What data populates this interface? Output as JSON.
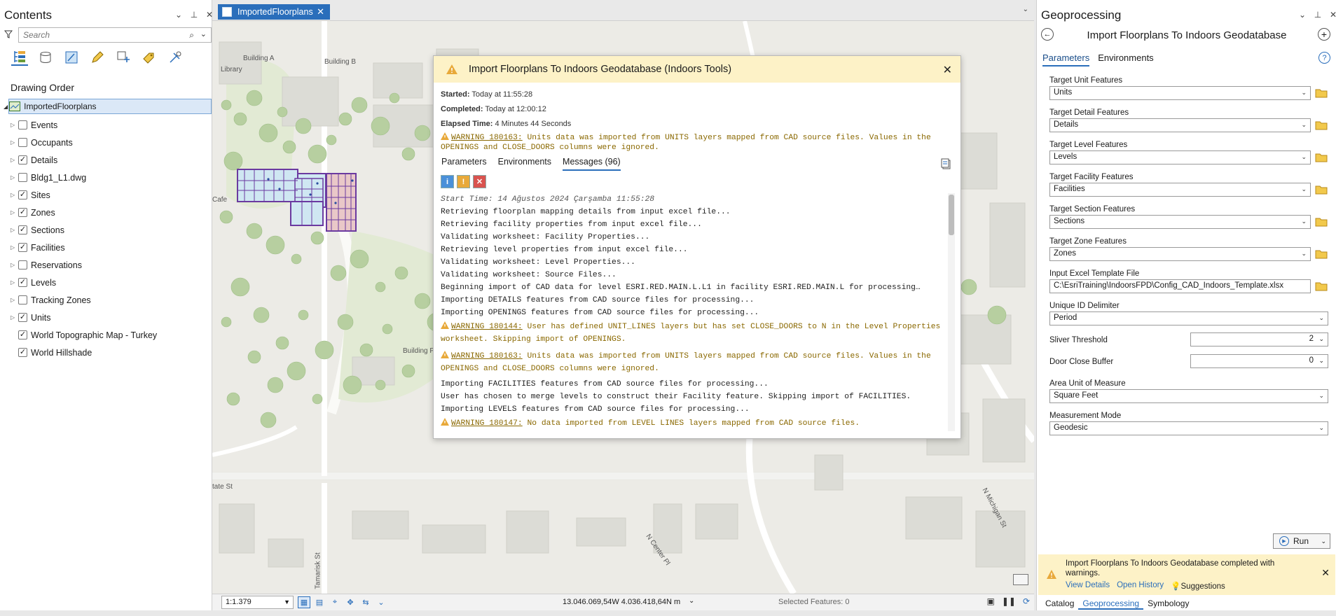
{
  "colors": {
    "accent": "#2a6ebb",
    "warning_bg": "#fdf2c7",
    "warning_text": "#8a6800"
  },
  "contents": {
    "title": "Contents",
    "search_placeholder": "Search",
    "drawing_order": "Drawing Order",
    "root_layer": "ImportedFloorplans",
    "layers": [
      {
        "name": "Events",
        "checked": false,
        "expandable": true
      },
      {
        "name": "Occupants",
        "checked": false,
        "expandable": true
      },
      {
        "name": "Details",
        "checked": true,
        "expandable": true
      },
      {
        "name": "Bldg1_L1.dwg",
        "checked": false,
        "expandable": true
      },
      {
        "name": "Sites",
        "checked": true,
        "expandable": true
      },
      {
        "name": "Zones",
        "checked": true,
        "expandable": true
      },
      {
        "name": "Sections",
        "checked": true,
        "expandable": true
      },
      {
        "name": "Facilities",
        "checked": true,
        "expandable": true
      },
      {
        "name": "Reservations",
        "checked": false,
        "expandable": true
      },
      {
        "name": "Levels",
        "checked": true,
        "expandable": true
      },
      {
        "name": "Tracking Zones",
        "checked": false,
        "expandable": true
      },
      {
        "name": "Units",
        "checked": true,
        "expandable": true
      },
      {
        "name": "World Topographic Map - Turkey",
        "checked": true,
        "expandable": false
      },
      {
        "name": "World Hillshade",
        "checked": true,
        "expandable": false
      }
    ]
  },
  "map": {
    "tab_label": "ImportedFloorplans",
    "labels": {
      "building_a": "Building A",
      "building_b": "Building B",
      "library": "Library",
      "cafe": "Cafe",
      "building_plan": "Building Plan",
      "state_st": "tate St",
      "center_pl": "N Center Pl",
      "michigan_st": "N Michigan St",
      "tamarisk_st": "Tamarisk St"
    }
  },
  "dialog": {
    "title": "Import Floorplans To Indoors Geodatabase (Indoors Tools)",
    "started_label": "Started:",
    "started_value": "Today at 11:55:28",
    "completed_label": "Completed:",
    "completed_value": "Today at 12:00:12",
    "elapsed_label": "Elapsed Time:",
    "elapsed_value": "4 Minutes 44 Seconds",
    "top_warning_code": "WARNING 180163:",
    "top_warning_text": " Units data was imported from UNITS layers mapped from CAD source files. Values in the OPENINGS and CLOSE_DOORS columns were ignored.",
    "tabs": [
      "Parameters",
      "Environments",
      "Messages (96)"
    ],
    "messages": [
      {
        "type": "italic",
        "text": "Start Time: 14 Ağustos 2024 Çarşamba 11:55:28"
      },
      {
        "type": "info",
        "text": "Retrieving floorplan mapping details from input excel file..."
      },
      {
        "type": "info",
        "text": "Retrieving facility properties from input excel file..."
      },
      {
        "type": "info",
        "text": "Validating worksheet: Facility Properties..."
      },
      {
        "type": "info",
        "text": "Retrieving level properties from input excel file..."
      },
      {
        "type": "info",
        "text": "Validating worksheet: Level Properties..."
      },
      {
        "type": "info",
        "text": "Validating worksheet: Source Files..."
      },
      {
        "type": "info",
        "text": "Beginning import of CAD data for level ESRI.RED.MAIN.L.L1 in facility ESRI.RED.MAIN.L for processing…"
      },
      {
        "type": "info",
        "text": "Importing DETAILS features from CAD source files for processing..."
      },
      {
        "type": "info",
        "text": "Importing OPENINGS features from CAD source files for processing..."
      },
      {
        "type": "warn",
        "code": "WARNING 180144:",
        "text": " User has defined UNIT_LINES layers but has set CLOSE_DOORS to N in the Level Properties worksheet. Skipping import of OPENINGS."
      },
      {
        "type": "warn",
        "code": "WARNING 180163:",
        "text": " Units data was imported from UNITS layers mapped from CAD source files. Values in the OPENINGS and CLOSE_DOORS columns were ignored."
      },
      {
        "type": "info",
        "text": "Importing FACILITIES features from CAD source files for processing..."
      },
      {
        "type": "info",
        "text": "User has chosen to merge levels to construct their Facility feature. Skipping import of FACILITIES."
      },
      {
        "type": "info",
        "text": "Importing LEVELS features from CAD source files for processing..."
      },
      {
        "type": "warn",
        "code": "WARNING 180147:",
        "text": " No data imported from LEVEL LINES layers mapped from CAD source files."
      }
    ]
  },
  "statusbar": {
    "scale": "1:1.379",
    "coords": "13.046.069,54W 4.036.418,64N m",
    "selected_features": "Selected Features: 0"
  },
  "geoprocessing": {
    "title": "Geoprocessing",
    "tool_title": "Import Floorplans To Indoors Geodatabase",
    "tabs": [
      "Parameters",
      "Environments"
    ],
    "params": [
      {
        "label": "Target Unit Features",
        "value": "Units"
      },
      {
        "label": "Target Detail Features",
        "value": "Details"
      },
      {
        "label": "Target Level Features",
        "value": "Levels"
      },
      {
        "label": "Target Facility Features",
        "value": "Facilities"
      },
      {
        "label": "Target Section Features",
        "value": "Sections"
      },
      {
        "label": "Target Zone Features",
        "value": "Zones"
      },
      {
        "label": "Input Excel Template File",
        "value": "C:\\EsriTraining\\IndoorsFPD\\Config_CAD_Indoors_Template.xlsx"
      },
      {
        "label": "Unique ID Delimiter",
        "value": "Period"
      },
      {
        "label": "Area Unit of Measure",
        "value": "Square Feet"
      },
      {
        "label": "Measurement Mode",
        "value": "Geodesic"
      }
    ],
    "sliver_label": "Sliver Threshold",
    "sliver_value": "2",
    "door_label": "Door Close Buffer",
    "door_value": "0",
    "run_label": "Run",
    "status_message": "Import Floorplans To Indoors Geodatabase completed with warnings.",
    "status_links": [
      "View Details",
      "Open History",
      "Suggestions"
    ],
    "bottom_tabs": [
      "Catalog",
      "Geoprocessing",
      "Symbology"
    ]
  }
}
